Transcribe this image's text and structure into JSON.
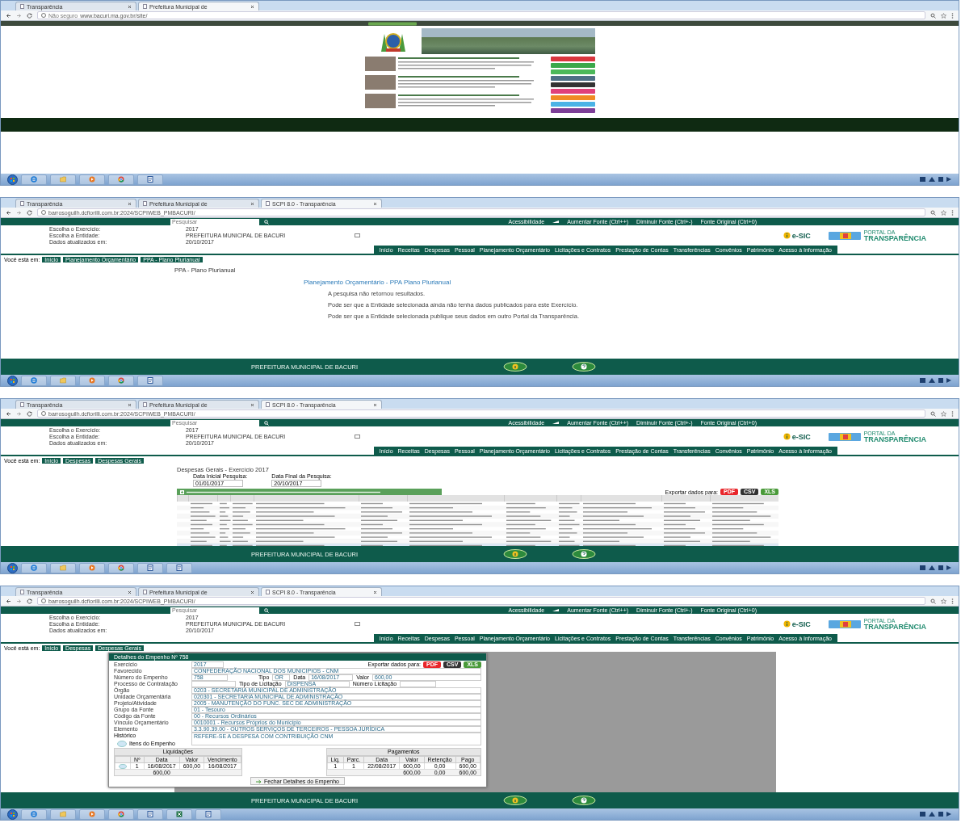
{
  "screenshots": [
    {
      "kind": "home",
      "tabs": [
        {
          "label": "Transparência",
          "selected": false
        },
        {
          "label": "Prefeitura Municipal de",
          "selected": true
        }
      ],
      "address": {
        "security": "Não seguro",
        "url": "www.bacuri.ma.gov.br/site/"
      },
      "site": {
        "shortcuts": [
          {
            "color": "#d9363e"
          },
          {
            "color": "#3aa84a"
          },
          {
            "color": "#4cb85a"
          },
          {
            "color": "#4e6f86"
          },
          {
            "color": "#333333"
          },
          {
            "color": "#e0407a"
          },
          {
            "color": "#f08a24"
          },
          {
            "color": "#4ab3e6"
          },
          {
            "color": "#7d3f98"
          }
        ]
      },
      "taskbar": {
        "apps": [
          {
            "kind": "ie"
          },
          {
            "kind": "folder"
          },
          {
            "kind": "media"
          },
          {
            "kind": "chrome"
          },
          {
            "kind": "doc"
          }
        ]
      }
    },
    {
      "kind": "portal",
      "tabs": [
        {
          "label": "Transparência",
          "selected": false
        },
        {
          "label": "Prefeitura Municipal de",
          "selected": false
        },
        {
          "label": "SCPI 8.0 - Transparência",
          "selected": true
        }
      ],
      "address": {
        "url": "barrosoguilh.dcfiorilli.com.br:2024/SCPIWEB_PMBACURI/"
      },
      "portal": {
        "search_placeholder": "Pesquisar",
        "accessibility": [
          "Acessibilidade",
          "Aumentar Fonte (Ctrl++)",
          "Diminuir Fonte (Ctrl+-)",
          "Fonte Original (Ctrl+0)"
        ],
        "info": [
          {
            "label": "Escolha o Exercício:",
            "value": "2017"
          },
          {
            "label": "Escolha a Entidade:",
            "value": "PREFEITURA MUNICIPAL DE BACURI"
          },
          {
            "label": "Dados atualizados em:",
            "value": "20/10/2017"
          }
        ],
        "esic": "e-SIC",
        "logo": [
          "PORTAL DA",
          "TRANSPARÊNCIA"
        ],
        "menu": [
          "Início",
          "Receitas",
          "Despesas",
          "Pessoal",
          "Planejamento Orçamentário",
          "Licitações e Contratos",
          "Prestação de Contas",
          "Transferências",
          "Convênios",
          "Patrimônio",
          "Acesso à Informação"
        ],
        "breadcrumb": {
          "label": "Você está em:",
          "items": [
            "Início",
            "Planejamento Orçamentário",
            "PPA - Plano Plurianual"
          ]
        },
        "footer": "PREFEITURA MUNICIPAL DE BACURI"
      },
      "body": {
        "kind": "message",
        "title": "PPA - Plano Plurianual",
        "heading": "Planejamento Orçamentário - PPA Plano Plurianual",
        "paragraphs": [
          "A pesquisa não retornou resultados.",
          "Pode ser que a Entidade selecionada ainda não tenha dados publicados para este Exercício.",
          "Pode ser que a Entidade selecionada publique seus dados em outro Portal da Transparência."
        ]
      },
      "taskbar": {
        "apps": [
          {
            "kind": "ie"
          },
          {
            "kind": "folder"
          },
          {
            "kind": "media"
          },
          {
            "kind": "chrome"
          },
          {
            "kind": "doc"
          }
        ]
      }
    },
    {
      "kind": "portal",
      "tabs": [
        {
          "label": "Transparência",
          "selected": false
        },
        {
          "label": "Prefeitura Municipal de",
          "selected": false
        },
        {
          "label": "SCPI 8.0 - Transparência",
          "selected": true
        }
      ],
      "address": {
        "url": "barrosoguilh.dcfiorilli.com.br:2024/SCPIWEB_PMBACURI/"
      },
      "portal": {
        "search_placeholder": "Pesquisar",
        "accessibility": [
          "Acessibilidade",
          "Aumentar Fonte (Ctrl++)",
          "Diminuir Fonte (Ctrl+-)",
          "Fonte Original (Ctrl+0)"
        ],
        "info": [
          {
            "label": "Escolha o Exercício:",
            "value": "2017"
          },
          {
            "label": "Escolha a Entidade:",
            "value": "PREFEITURA MUNICIPAL DE BACURI"
          },
          {
            "label": "Dados atualizados em:",
            "value": "20/10/2017"
          }
        ],
        "esic": "e-SIC",
        "logo": [
          "PORTAL DA",
          "TRANSPARÊNCIA"
        ],
        "menu": [
          "Início",
          "Receitas",
          "Despesas",
          "Pessoal",
          "Planejamento Orçamentário",
          "Licitações e Contratos",
          "Prestação de Contas",
          "Transferências",
          "Convênios",
          "Patrimônio",
          "Acesso à Informação"
        ],
        "breadcrumb": {
          "label": "Você está em:",
          "items": [
            "Início",
            "Despesas",
            "Despesas Gerais"
          ]
        },
        "footer": "PREFEITURA MUNICIPAL DE BACURI"
      },
      "body": {
        "kind": "table",
        "title": "Despesas Gerais - Exercício 2017",
        "filters": [
          {
            "label": "Data Inicial Pesquisa:",
            "value": "01/01/2017"
          },
          {
            "label": "Data Final da Pesquisa:",
            "value": "20/10/2017"
          }
        ],
        "export": {
          "label": "Exportar dados para:",
          "formats": [
            "PDF",
            "CSV",
            "XLS"
          ]
        }
      },
      "taskbar": {
        "apps": [
          {
            "kind": "ie"
          },
          {
            "kind": "folder"
          },
          {
            "kind": "media"
          },
          {
            "kind": "chrome"
          },
          {
            "kind": "doc"
          },
          {
            "kind": "doc"
          }
        ]
      }
    },
    {
      "kind": "portal",
      "tabs": [
        {
          "label": "Transparência",
          "selected": false
        },
        {
          "label": "Prefeitura Municipal de",
          "selected": false
        },
        {
          "label": "SCPI 8.0 - Transparência",
          "selected": true
        }
      ],
      "address": {
        "url": "barrosoguilh.dcfiorilli.com.br:2024/SCPIWEB_PMBACURI/"
      },
      "portal": {
        "search_placeholder": "Pesquisar",
        "accessibility": [
          "Acessibilidade",
          "Aumentar Fonte (Ctrl++)",
          "Diminuir Fonte (Ctrl+-)",
          "Fonte Original (Ctrl+0)"
        ],
        "info": [
          {
            "label": "Escolha o Exercício:",
            "value": "2017"
          },
          {
            "label": "Escolha a Entidade:",
            "value": "PREFEITURA MUNICIPAL DE BACURI"
          },
          {
            "label": "Dados atualizados em:",
            "value": "20/10/2017"
          }
        ],
        "esic": "e-SIC",
        "logo": [
          "PORTAL DA",
          "TRANSPARÊNCIA"
        ],
        "menu": [
          "Início",
          "Receitas",
          "Despesas",
          "Pessoal",
          "Planejamento Orçamentário",
          "Licitações e Contratos",
          "Prestação de Contas",
          "Transferências",
          "Convênios",
          "Patrimônio",
          "Acesso à Informação"
        ],
        "breadcrumb": {
          "label": "Você está em:",
          "items": [
            "Início",
            "Despesas",
            "Despesas Gerais"
          ]
        },
        "footer": "PREFEITURA MUNICIPAL DE BACURI"
      },
      "body": {
        "kind": "modal",
        "modal": {
          "title": "Detalhes do Empenho Nº 758",
          "export": {
            "label": "Exportar dados para:",
            "formats": [
              "PDF",
              "CSV",
              "XLS"
            ]
          },
          "exercicio": {
            "label": "Exercício",
            "value": "2017"
          },
          "favorecido": {
            "label": "Favorecido",
            "value": "CONFEDERAÇÃO NACIONAL DOS MUNICIPIOS - CNM"
          },
          "numero": {
            "label": "Número do Empenho",
            "value": "758"
          },
          "tipo": {
            "label": "Tipo",
            "value": "OR"
          },
          "data": {
            "label": "Data",
            "value": "16/08/2017"
          },
          "valor": {
            "label": "Valor",
            "value": "600,00"
          },
          "processo": {
            "label": "Processo de Contratação"
          },
          "tipo_licitacao": {
            "label": "Tipo de Licitação",
            "value": "DISPENSA"
          },
          "numero_licitacao": {
            "label": "Número Licitação"
          },
          "fields": [
            {
              "label": "Órgão",
              "value": "0203 - SECRETARIA MUNICIPAL DE ADMINISTRAÇÃO"
            },
            {
              "label": "Unidade Orçamentária",
              "value": "020301 - SECRETARIA MUNICIPAL DE ADMINISTRAÇÃO"
            },
            {
              "label": "Projeto/Atividade",
              "value": "2005 - MANUTENÇÃO DO FUNC. SEC DE ADMINISTRAÇÃO"
            },
            {
              "label": "Grupo da Fonte",
              "value": "01 - Tesouro"
            },
            {
              "label": "Código da Fonte",
              "value": "00 - Recursos Ordinários"
            },
            {
              "label": "Vínculo Orçamentário",
              "value": "0010001 - Recursos Próprios do Município"
            },
            {
              "label": "Elemento",
              "value": "3.3.90.39.00 - OUTROS SERVIÇOS DE TERCEIROS - PESSOA JURÍDICA"
            }
          ],
          "historico": {
            "label": "Histórico",
            "value": "REFERE-SE A DESPESA COM CONTRIBUIÇÃO CNM"
          },
          "itens": "Itens do Empenho",
          "liquidacoes": {
            "title": "Liquidações",
            "columns": [
              "Nº",
              "Data",
              "Valor",
              "Vencimento"
            ],
            "rows": [
              [
                "1",
                "16/08/2017",
                "600,00",
                "16/08/2017"
              ]
            ],
            "totals": [
              "600,00"
            ]
          },
          "pagamentos": {
            "title": "Pagamentos",
            "columns": [
              "Liq.",
              "Parc.",
              "Data",
              "Valor",
              "Retenção",
              "Pago"
            ],
            "rows": [
              [
                "1",
                "1",
                "22/08/2017",
                "600,00",
                "0,00",
                "600,00"
              ]
            ],
            "totals": [
              "600,00",
              "0,00",
              "600,00"
            ]
          },
          "close": "Fechar Detalhes do Empenho"
        }
      },
      "taskbar": {
        "apps": [
          {
            "kind": "ie"
          },
          {
            "kind": "folder"
          },
          {
            "kind": "media"
          },
          {
            "kind": "chrome"
          },
          {
            "kind": "doc"
          },
          {
            "kind": "sheet"
          },
          {
            "kind": "doc"
          }
        ]
      }
    }
  ]
}
